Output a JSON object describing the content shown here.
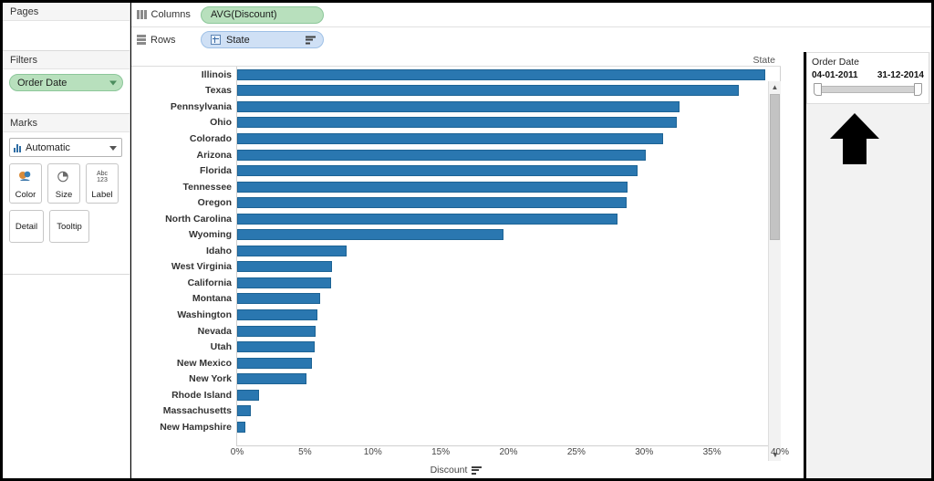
{
  "left_panel": {
    "pages": {
      "title": "Pages"
    },
    "filters": {
      "title": "Filters",
      "pills": [
        {
          "label": "Order Date",
          "color": "#b8e0bd"
        }
      ]
    },
    "marks": {
      "title": "Marks",
      "type_label": "Automatic",
      "type_icon": "bar-chart-icon",
      "buttons": [
        {
          "label": "Color",
          "icon": "color-palette-icon"
        },
        {
          "label": "Size",
          "icon": "size-circle-icon"
        },
        {
          "label": "Label",
          "icon": "abc-123-icon",
          "icon_line1": "Abc",
          "icon_line2": "123"
        },
        {
          "label": "Detail",
          "icon": "detail-icon"
        },
        {
          "label": "Tooltip",
          "icon": "tooltip-icon"
        }
      ]
    }
  },
  "shelves": [
    {
      "name": "Columns",
      "icon": "columns-icon",
      "pill": {
        "label": "AVG(Discount)",
        "type": "green",
        "expandable": false,
        "sorted": false
      }
    },
    {
      "name": "Rows",
      "icon": "rows-icon",
      "pill": {
        "label": "State",
        "type": "blue",
        "expandable": true,
        "sorted": true
      }
    }
  ],
  "viz": {
    "row_header_title": "State",
    "axis_title": "Discount",
    "axis_sort_icon": "sort-descending-icon",
    "scrollbar": {
      "up_icon": "chevron-up-icon",
      "down_icon": "chevron-down-icon"
    }
  },
  "right_panel": {
    "date_filter": {
      "title": "Order Date",
      "start": "04-01-2011",
      "end": "31-12-2014"
    },
    "annotation": {
      "icon": "up-arrow-annotation",
      "color": "#000000"
    }
  },
  "chart_data": {
    "type": "bar",
    "title": "",
    "orientation": "horizontal",
    "xlabel": "Discount",
    "ylabel": "State",
    "xlim": [
      0,
      40
    ],
    "x_ticks": [
      0,
      5,
      10,
      15,
      20,
      25,
      30,
      35,
      40
    ],
    "x_tick_labels": [
      "0%",
      "5%",
      "10%",
      "15%",
      "20%",
      "25%",
      "30%",
      "35%",
      "40%"
    ],
    "grid": false,
    "legend": "none",
    "bar_color": "#2a77b0",
    "sorted": "descending",
    "categories": [
      "Illinois",
      "Texas",
      "Pennsylvania",
      "Ohio",
      "Colorado",
      "Arizona",
      "Florida",
      "Tennessee",
      "Oregon",
      "North Carolina",
      "Wyoming",
      "Idaho",
      "West Virginia",
      "California",
      "Montana",
      "Washington",
      "Nevada",
      "Utah",
      "New Mexico",
      "New York",
      "Rhode Island",
      "Massachusetts",
      "New Hampshire"
    ],
    "values": [
      38.9,
      37.0,
      32.6,
      32.4,
      31.4,
      30.1,
      29.5,
      28.8,
      28.7,
      28.0,
      19.6,
      8.1,
      7.0,
      6.9,
      6.1,
      5.9,
      5.8,
      5.7,
      5.5,
      5.1,
      1.6,
      1.0,
      0.6
    ],
    "value_unit": "%"
  }
}
